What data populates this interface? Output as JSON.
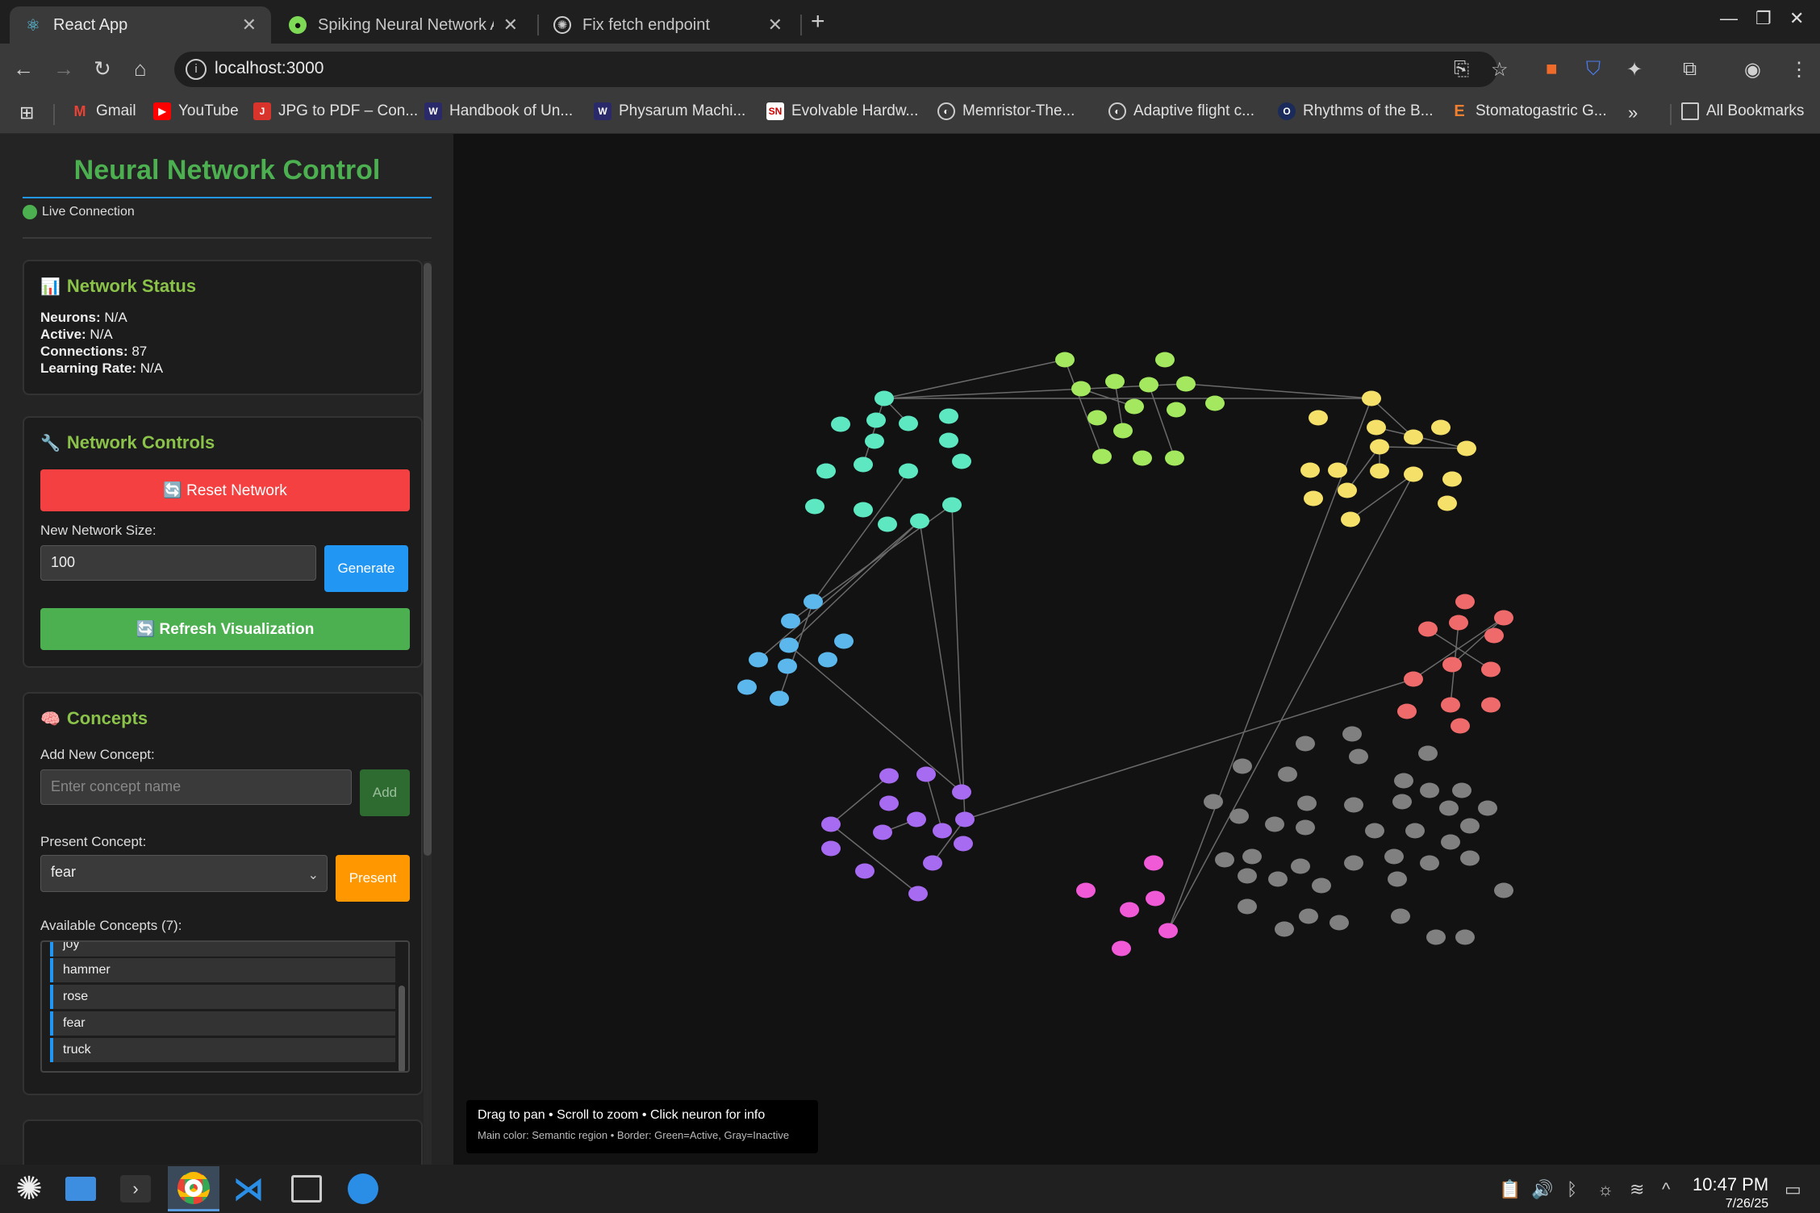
{
  "browser": {
    "tabs": [
      {
        "title": "React App",
        "active": true
      },
      {
        "title": "Spiking Neural Network API",
        "active": false
      },
      {
        "title": "Fix fetch endpoint",
        "active": false
      }
    ],
    "url": "localhost:3000",
    "bookmarks": [
      "Gmail",
      "YouTube",
      "JPG to PDF – Con...",
      "Handbook of Un...",
      "Physarum Machi...",
      "Evolvable Hardw...",
      "Memristor-The...",
      "Adaptive flight c...",
      "Rhythms of the B...",
      "Stomatogastric G..."
    ],
    "all_bookmarks": "All Bookmarks",
    "overflow": "»"
  },
  "sidebar": {
    "title": "Neural Network Control",
    "connection": "Live Connection",
    "status": {
      "heading": "Network Status",
      "icon": "📊",
      "neurons_label": "Neurons:",
      "neurons": "N/A",
      "active_label": "Active:",
      "active": "N/A",
      "connections_label": "Connections:",
      "connections": "87",
      "lr_label": "Learning Rate:",
      "lr": "N/A"
    },
    "controls": {
      "heading": "Network Controls",
      "icon": "🔧",
      "reset_label": "🔄 Reset Network",
      "size_label": "New Network Size:",
      "size_value": "100",
      "generate_label": "Generate",
      "refresh_label": "🔄 Refresh Visualization"
    },
    "concepts": {
      "heading": "Concepts",
      "icon": "🧠",
      "add_label": "Add New Concept:",
      "add_placeholder": "Enter concept name",
      "add_button": "Add",
      "present_label": "Present Concept:",
      "present_value": "fear",
      "present_button": "Present",
      "available_label": "Available Concepts (7):",
      "items": [
        "joy",
        "hammer",
        "rose",
        "fear",
        "truck"
      ]
    }
  },
  "canvas": {
    "hint_line1": "Drag to pan • Scroll to zoom • Click neuron for info",
    "hint_line2": "Main color: Semantic region • Border: Green=Active, Gray=Inactive",
    "colors": {
      "lime": "#a3e85f",
      "teal": "#5ee8c2",
      "yellow": "#f5e06a",
      "blue": "#5cb8ec",
      "red": "#ef6b6b",
      "purple": "#a66bf0",
      "pink": "#f05ad6",
      "gray": "#808080"
    }
  },
  "taskbar": {
    "time": "10:47 PM",
    "date": "7/26/25"
  }
}
